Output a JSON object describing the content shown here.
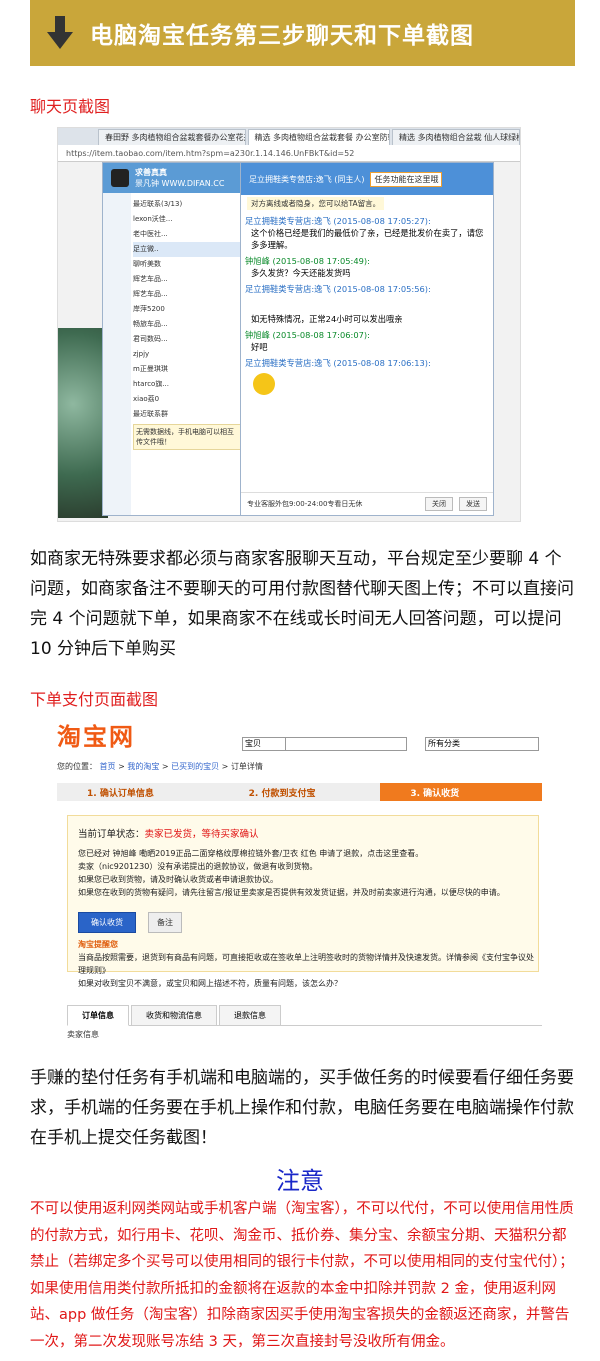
{
  "banner": {
    "title": "电脑淘宝任务第三步聊天和下单截图",
    "icon": "down-arrow-icon",
    "bg_color": "#c9a63a"
  },
  "section1": {
    "label": "聊天页截图",
    "browser": {
      "tabs": [
        "春田野 多肉植物组合盆栽套餐办公室花卉",
        "精选 多肉植物组合盆栽套餐 办公室防辐",
        "精选 多肉植物组合盆栽 仙人球绿植"
      ],
      "url": "https://item.taobao.com/item.htm?spm=a230r.1.14.146.UnFBkT&id=52"
    },
    "wangwang": {
      "user": "求善真真",
      "subtitle": "景凡钟 WWW.DIFAN.CC",
      "recent_header": "最近联系(3/13)",
      "contacts": [
        "lexon沃佳...",
        "老中医社...",
        "足立微..",
        "聊听美数",
        "辉艺车品...",
        "辉艺车品...",
        "岸萍5200",
        "畅旅车品...",
        "君司数码...",
        "zjpjy",
        "m正曼琪琪",
        "htarco旗...",
        "xiao荔0"
      ],
      "group_header": "最近联系群",
      "promo": "无需数据线，手机电脑可以相互传文件哦！"
    },
    "chat": {
      "shop": "足立拥鞋类专营店:逸飞 (同主人)",
      "tooltip": "任务功能在这里哦",
      "notice": "对方离线或者隐身，您可以给TA留言。",
      "messages": [
        {
          "who": "足立拥鞋类专营店:逸飞 (2015-08-08 17:05:27):",
          "text": "这个价格已经是我们的最低价了亲，已经是批发价在卖了，请您多多理解。"
        },
        {
          "who": "钟旭峰 (2015-08-08 17:05:49):",
          "text": "多久发货？今天还能发货吗"
        },
        {
          "who": "足立拥鞋类专营店:逸飞 (2015-08-08 17:05:56):",
          "text": "如无特殊情况，正常24小时可以发出哦亲"
        },
        {
          "who": "钟旭峰 (2015-08-08 17:06:07):",
          "text": "好吧"
        },
        {
          "who": "足立拥鞋类专营店:逸飞 (2015-08-08 17:06:13):",
          "text": ""
        }
      ],
      "footer": "专业客服外包9:00-24:00专看日无休",
      "close_label": "关闭",
      "send_label": "发送"
    }
  },
  "para1": "如商家无特殊要求都必须与商家客服聊天互动，平台规定至少要聊 4 个问题，如商家备注不要聊天的可用付款图替代聊天图上传；不可以直接问完 4 个问题就下单，如果商家不在线或长时间无人回答问题，可以提问 10 分钟后下单购买",
  "section2": {
    "label": "下单支付页面截图",
    "taobao": {
      "logo": "淘宝网",
      "search_scope": "宝贝",
      "category": "所有分类",
      "breadcrumb_prefix": "您的位置：",
      "breadcrumb": [
        "首页",
        "我的淘宝",
        "已买到的宝贝"
      ],
      "breadcrumb_current": "订单详情",
      "steps": [
        "1. 确认订单信息",
        "2. 付款到支付宝",
        "3. 确认收货"
      ],
      "state_prefix": "当前订单状态：",
      "state": "卖家已发货，等待买家确认",
      "lines": [
        "您已经对 钟旭峰 嘞晒2019正品二面穿格纹厚棉拉链外套/卫衣 红色 申请了退款，点击这里查看。",
        "卖家（nic9201230）没有承诺提出的退款协议，做退有收到货物。",
        "如果您已收到货物，请及时确认收货或者申请退款协议。",
        "如果您在收到的货物有疑问，请先往留言/报证里卖家是否提供有效发货证据，并及时前卖家进行沟通，以便尽快的申请。"
      ],
      "confirm_btn": "确认收货",
      "remark_btn": "备注",
      "tips_title": "淘宝提醒您",
      "tips": [
        "当商品按照需要，退货到有商品有问题，可直接拒收或在签收单上注明签收时的货物详情并及快速发货。详情参阅《支付宝争议处理规则》",
        "如果对收到宝贝不满意，或宝贝和网上描述不符，质量有问题，该怎么办？"
      ],
      "tabs": [
        "订单信息",
        "收货和物流信息",
        "退款信息"
      ],
      "seller_label": "卖家信息"
    }
  },
  "para2": "手赚的垫付任务有手机端和电脑端的，买手做任务的时候要看仔细任务要求，手机端的任务要在手机上操作和付款，电脑任务要在电脑端操作付款在手机上提交任务截图！",
  "notice": {
    "title": "注意",
    "text": "不可以使用返利网类网站或手机客户端（淘宝客），不可以代付，不可以使用信用性质的付款方式，如行用卡、花呗、淘金币、抵价券、集分宝、余额宝分期、天猫积分都禁止（若绑定多个买号可以使用相同的银行卡付款，不可以使用相同的支付宝代付）；如果使用信用类付款所抵扣的金额将在返款的本金中扣除并罚款 2 金，使用返利网站、app 做任务（淘宝客）扣除商家因买手使用淘宝客损失的金额返还商家，并警告一次，第二次发现账号冻结 3 天，第三次直接封号没收所有佣金。",
    "title_color": "#1a28c8",
    "text_color": "#e01818"
  }
}
